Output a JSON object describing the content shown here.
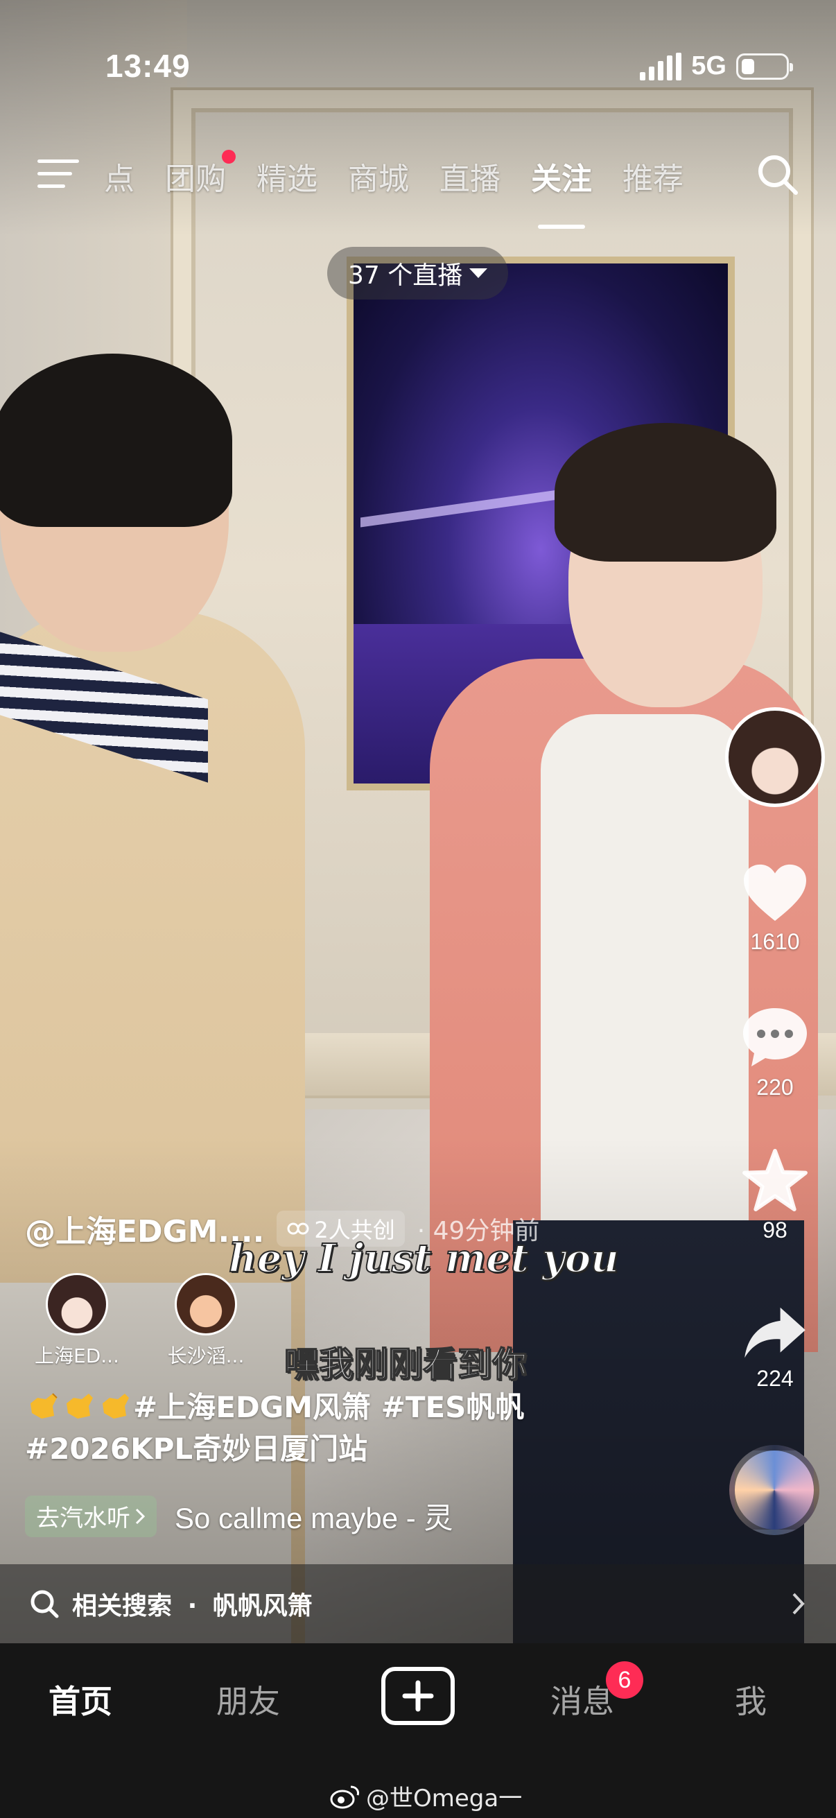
{
  "status_bar": {
    "time": "13:49",
    "network": "5G",
    "battery_level": 0.3
  },
  "top_nav": {
    "tabs": [
      {
        "label": "点",
        "active": false,
        "dot": false
      },
      {
        "label": "团购",
        "active": false,
        "dot": true
      },
      {
        "label": "精选",
        "active": false,
        "dot": false
      },
      {
        "label": "商城",
        "active": false,
        "dot": false
      },
      {
        "label": "直播",
        "active": false,
        "dot": false
      },
      {
        "label": "关注",
        "active": true,
        "dot": false
      },
      {
        "label": "推荐",
        "active": false,
        "dot": false
      }
    ],
    "live_pill": "37 个直播"
  },
  "actions": {
    "likes": "1610",
    "comments": "220",
    "favorites": "98",
    "shares": "224"
  },
  "video": {
    "author": "@上海EDGM....",
    "co_create": "2人共创",
    "time_ago": "· 49分钟前",
    "coauthors": [
      {
        "name": "上海ED..."
      },
      {
        "name": "长沙滔..."
      }
    ],
    "subtitle_en": "hey I just met you",
    "subtitle_cn": "嘿我刚刚看到你",
    "description_line1": "#上海EDGM风箫 #TES帆帆",
    "description_line2": "#2026KPL奇妙日厦门站",
    "music_chip": "去汽水听",
    "music_title": "So callme maybe - 灵"
  },
  "related_search": {
    "label": "相关搜索",
    "separator": "·",
    "query": "帆帆风箫"
  },
  "bottom_nav": {
    "home": "首页",
    "friends": "朋友",
    "messages": "消息",
    "messages_badge": "6",
    "me": "我"
  },
  "watermark": "@世Omega一",
  "colors": {
    "accent": "#fe2c55",
    "nav_bg": "#161616"
  }
}
